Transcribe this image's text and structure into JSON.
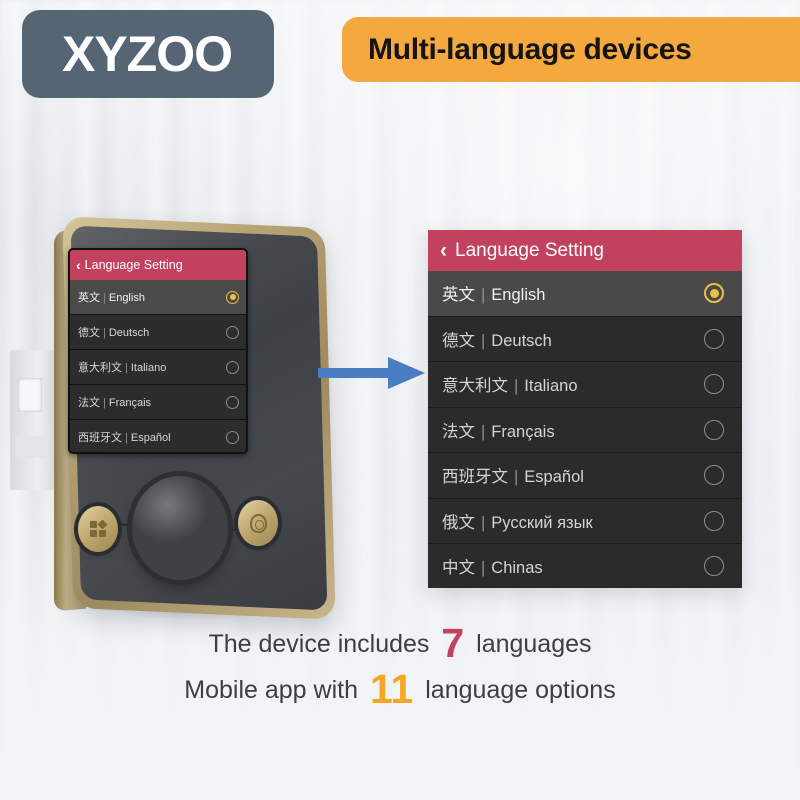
{
  "brand": {
    "logo_text": "XYZOO",
    "logo_badge_color": "#566574",
    "ring_icon": "ring-diamond-icon",
    "circle_icon": "circle-bar-icon"
  },
  "banner": {
    "title": "Multi-language devices",
    "background_color": "#f4a83d",
    "text_color": "#141414"
  },
  "device": {
    "name": "smart-door-lock",
    "knob_label": "thumb-turn-knob",
    "keypad_button_label": "keypad-button",
    "fingerprint_button_label": "fingerprint-button",
    "screen": {
      "header": {
        "back_icon": "‹",
        "title": "Language Setting",
        "background_color": "#c2415f"
      },
      "rows": [
        {
          "cn": "英文",
          "sep": "|",
          "name": "English",
          "selected": true
        },
        {
          "cn": "德文",
          "sep": "|",
          "name": "Deutsch",
          "selected": false
        },
        {
          "cn": "意大利文",
          "sep": "|",
          "name": "Italiano",
          "selected": false
        },
        {
          "cn": "法文",
          "sep": "|",
          "name": "Français",
          "selected": false
        },
        {
          "cn": "西班牙文",
          "sep": "|",
          "name": "Español",
          "selected": false
        }
      ]
    }
  },
  "arrow": {
    "name": "blue-right-arrow",
    "color": "#4a7ec4",
    "direction": "right"
  },
  "panel": {
    "header": {
      "back_icon": "‹",
      "title": "Language Setting",
      "background_color": "#c2415f"
    },
    "selected_color": "#e6bf46",
    "rows": [
      {
        "cn": "英文",
        "sep": "|",
        "name": "English",
        "selected": true
      },
      {
        "cn": "德文",
        "sep": "|",
        "name": "Deutsch",
        "selected": false
      },
      {
        "cn": "意大利文",
        "sep": "|",
        "name": "Italiano",
        "selected": false
      },
      {
        "cn": "法文",
        "sep": "|",
        "name": "Français",
        "selected": false
      },
      {
        "cn": "西班牙文",
        "sep": "|",
        "name": "Español",
        "selected": false
      },
      {
        "cn": "俄文",
        "sep": "|",
        "name": "Русский язык",
        "selected": false
      },
      {
        "cn": "中文",
        "sep": "|",
        "name": "Chinas",
        "selected": false
      }
    ]
  },
  "captions": {
    "line1_pre": "The device includes",
    "line1_num": "7",
    "line1_post": "languages",
    "line1_num_color": "#c2415f",
    "line2_pre": "Mobile app with",
    "line2_num": "11",
    "line2_post": "language options",
    "line2_num_color": "#f5a623"
  }
}
